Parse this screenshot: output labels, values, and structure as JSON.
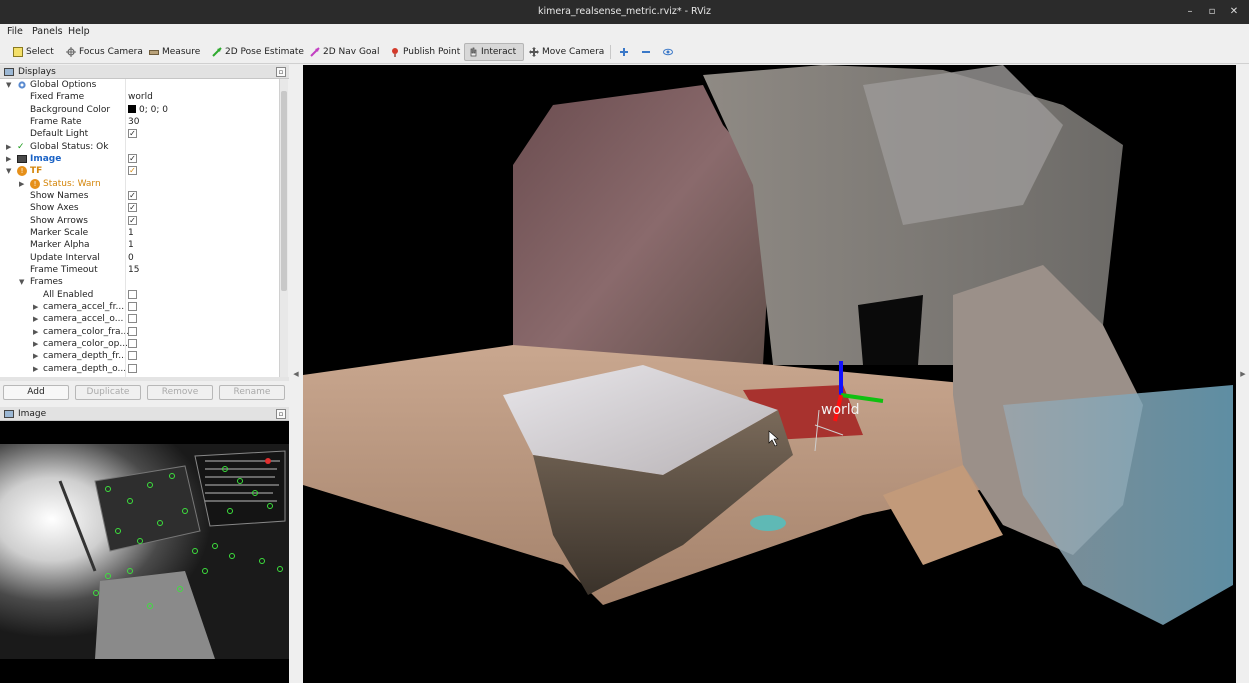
{
  "window": {
    "title": "kimera_realsense_metric.rviz* - RViz",
    "controls": [
      "–",
      "▫",
      "✕"
    ]
  },
  "menu": [
    "File",
    "Panels",
    "Help"
  ],
  "toolbar": {
    "tools": [
      {
        "label": "Select",
        "icon": "select-icon"
      },
      {
        "label": "Focus Camera",
        "icon": "focus-camera-icon"
      },
      {
        "label": "Measure",
        "icon": "measure-icon"
      },
      {
        "label": "2D Pose Estimate",
        "icon": "pose-estimate-icon"
      },
      {
        "label": "2D Nav Goal",
        "icon": "nav-goal-icon"
      },
      {
        "label": "Publish Point",
        "icon": "publish-point-icon"
      },
      {
        "label": "Interact",
        "icon": "interact-icon",
        "active": true
      },
      {
        "label": "Move Camera",
        "icon": "move-camera-icon"
      }
    ],
    "extra_icons": [
      "add-tool-icon",
      "remove-tool-icon",
      "eye-icon"
    ]
  },
  "displays_panel": {
    "title": "Displays",
    "tree": {
      "global_options": "Global Options",
      "fixed_frame": {
        "label": "Fixed Frame",
        "value": "world"
      },
      "background_color": {
        "label": "Background Color",
        "value": "0; 0; 0",
        "color": "#000000"
      },
      "frame_rate": {
        "label": "Frame Rate",
        "value": "30"
      },
      "default_light": {
        "label": "Default Light",
        "checked": true
      },
      "global_status": "Global Status: Ok",
      "image": {
        "label": "Image",
        "checked": true
      },
      "tf": {
        "label": "TF",
        "checked": true
      },
      "status_warn": "Status: Warn",
      "show_names": {
        "label": "Show Names",
        "checked": true
      },
      "show_axes": {
        "label": "Show Axes",
        "checked": true
      },
      "show_arrows": {
        "label": "Show Arrows",
        "checked": true
      },
      "marker_scale": {
        "label": "Marker Scale",
        "value": "1"
      },
      "marker_alpha": {
        "label": "Marker Alpha",
        "value": "1"
      },
      "update_interval": {
        "label": "Update Interval",
        "value": "0"
      },
      "frame_timeout": {
        "label": "Frame Timeout",
        "value": "15"
      },
      "frames": "Frames",
      "all_enabled": "All Enabled",
      "frame_items": [
        "camera_accel_fr...",
        "camera_accel_o...",
        "camera_color_fra...",
        "camera_color_op...",
        "camera_depth_fr...",
        "camera_depth_o..."
      ]
    },
    "buttons": {
      "add": "Add",
      "duplicate": "Duplicate",
      "remove": "Remove",
      "rename": "Rename"
    }
  },
  "image_panel": {
    "title": "Image"
  },
  "view3d": {
    "frame_label": "world"
  },
  "colors": {
    "ok": "#1a9a1a",
    "warn": "#d4860b",
    "link": "#1b63c6"
  }
}
